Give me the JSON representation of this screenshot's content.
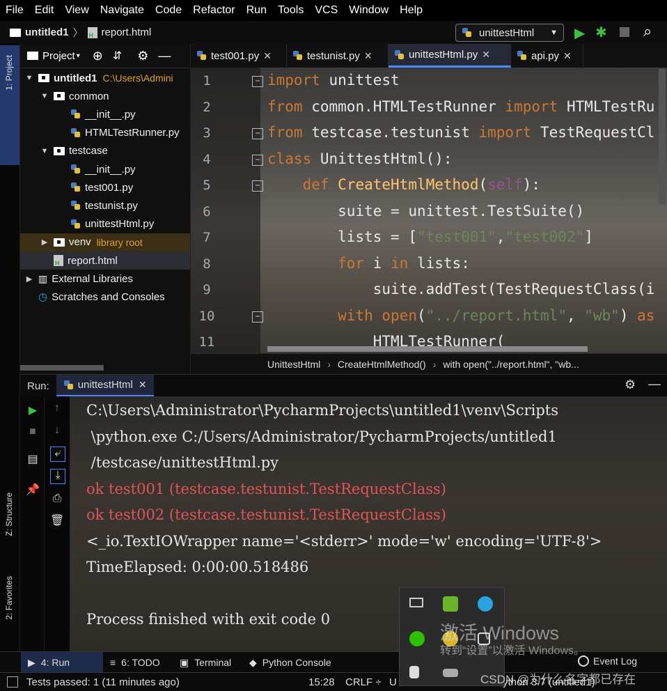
{
  "menu": [
    "File",
    "Edit",
    "View",
    "Navigate",
    "Code",
    "Refactor",
    "Run",
    "Tools",
    "VCS",
    "Window",
    "Help"
  ],
  "nav": {
    "project": "untitled1",
    "file": "report.html",
    "run_config": "unittestHtml"
  },
  "left_stripe": {
    "project_tab": "1: Project",
    "structure_tab": "Z: Structure",
    "favorites_tab": "2: Favorites"
  },
  "project_panel": {
    "title": "Project"
  },
  "tree": [
    {
      "label": "untitled1",
      "extra": "C:\\Users\\Admini",
      "icon": "folder",
      "level": 0,
      "expanded": true
    },
    {
      "label": "common",
      "icon": "folder",
      "level": 1,
      "expanded": true
    },
    {
      "label": "__init__.py",
      "icon": "py",
      "level": 2
    },
    {
      "label": "HTMLTestRunner.py",
      "icon": "py",
      "level": 2
    },
    {
      "label": "testcase",
      "icon": "folder",
      "level": 1,
      "expanded": true
    },
    {
      "label": "__init__.py",
      "icon": "py",
      "level": 2
    },
    {
      "label": "test001.py",
      "icon": "py",
      "level": 2
    },
    {
      "label": "testunist.py",
      "icon": "py",
      "level": 2
    },
    {
      "label": "unittestHtml.py",
      "icon": "py",
      "level": 2
    },
    {
      "label": "venv",
      "extra": "library root",
      "icon": "folder",
      "level": 1,
      "expanded": false
    },
    {
      "label": "report.html",
      "icon": "html",
      "level": 1
    },
    {
      "label": "External Libraries",
      "icon": "lib",
      "level": 0,
      "expanded": false
    },
    {
      "label": "Scratches and Consoles",
      "icon": "scratch",
      "level": 0
    }
  ],
  "editor_tabs": [
    {
      "label": "test001.py",
      "active": false
    },
    {
      "label": "testunist.py",
      "active": false
    },
    {
      "label": "unittestHtml.py",
      "active": true
    },
    {
      "label": "api.py",
      "active": false
    }
  ],
  "code_lines": [
    {
      "n": "1",
      "text": "import unittest"
    },
    {
      "n": "2",
      "text": "from common.HTMLTestRunner import HTMLTestRu"
    },
    {
      "n": "3",
      "text": "from testcase.testunist import TestRequestCl"
    },
    {
      "n": "4",
      "text": "class UnittestHtml():"
    },
    {
      "n": "5",
      "text": "    def CreateHtmlMethod(self):"
    },
    {
      "n": "6",
      "text": "        suite = unittest.TestSuite()"
    },
    {
      "n": "7",
      "text": "        lists = [\"test001\",\"test002\"]"
    },
    {
      "n": "8",
      "text": "        for i in lists:"
    },
    {
      "n": "9",
      "text": "            suite.addTest(TestRequestClass(i"
    },
    {
      "n": "10",
      "text": "        with open(\"../report.html\", \"wb\") as"
    },
    {
      "n": "11",
      "text": "            HTMLTestRunner("
    }
  ],
  "breadcrumb": [
    "UnittestHtml",
    "CreateHtmlMethod()",
    "with open(\"../report.html\", \"wb..."
  ],
  "run_panel": {
    "label": "Run:",
    "tab": "unittestHtml"
  },
  "console_lines": [
    {
      "text": "C:\\Users\\Administrator\\PycharmProjects\\untitled1\\venv\\Scripts",
      "type": "normal"
    },
    {
      "text": " \\python.exe C:/Users/Administrator/PycharmProjects/untitled1",
      "type": "normal"
    },
    {
      "text": " /testcase/unittestHtml.py",
      "type": "normal"
    },
    {
      "text": "ok test001 (testcase.testunist.TestRequestClass)",
      "type": "err"
    },
    {
      "text": "ok test002 (testcase.testunist.TestRequestClass)",
      "type": "err"
    },
    {
      "text": "<_io.TextIOWrapper name='<stderr>' mode='w' encoding='UTF-8'>",
      "type": "normal"
    },
    {
      "text": "TimeElapsed: 0:00:00.518486",
      "type": "normal"
    },
    {
      "text": "",
      "type": "normal"
    },
    {
      "text": "Process finished with exit code 0",
      "type": "normal"
    }
  ],
  "bottom_tabs": [
    {
      "label": "4: Run",
      "active": true
    },
    {
      "label": "6: TODO",
      "active": false
    },
    {
      "label": "Terminal",
      "active": false
    },
    {
      "label": "Python Console",
      "active": false
    }
  ],
  "event_log": "Event Log",
  "status": {
    "message": "Tests passed: 1 (11 minutes ago)",
    "position": "15:28",
    "line_sep": "CRLF ÷",
    "encoding": "U",
    "interpreter": "ython 3.7 (untitled1)",
    "vcs": ""
  },
  "watermark": {
    "line1": "激活 Windows",
    "line2": "转到“设置”以激活 Windows。"
  },
  "csdn": "CSDN @为什么名字都已存在"
}
